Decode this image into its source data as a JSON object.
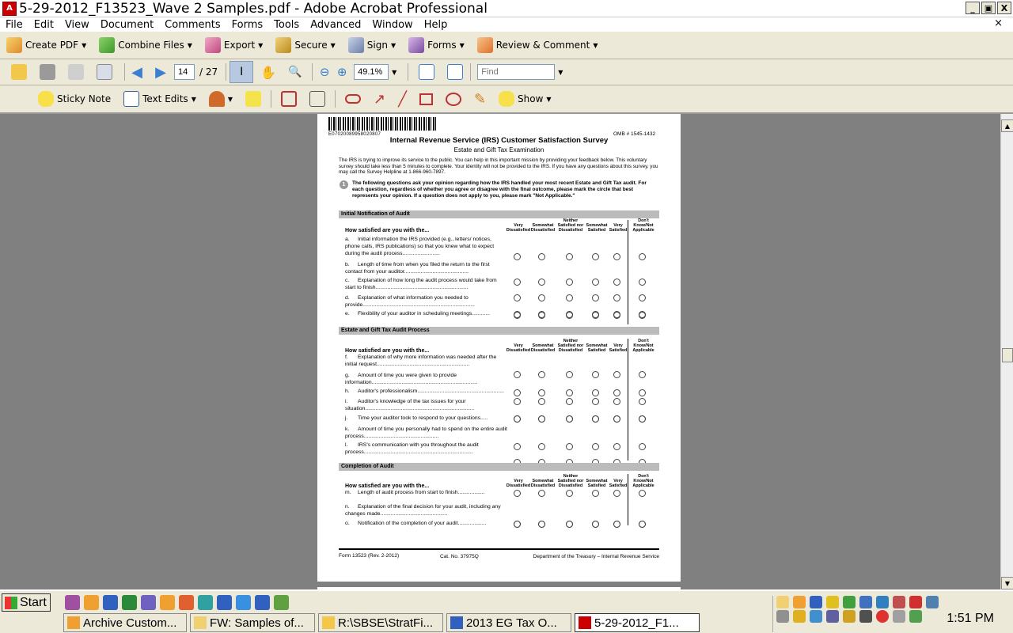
{
  "window": {
    "title": "5-29-2012_F13523_Wave 2 Samples.pdf - Adobe Acrobat Professional",
    "pdf_badge": "A"
  },
  "menu": [
    "File",
    "Edit",
    "View",
    "Document",
    "Comments",
    "Forms",
    "Tools",
    "Advanced",
    "Window",
    "Help"
  ],
  "window_controls": {
    "minimize": "_",
    "restore": "▣",
    "close": "X",
    "doc_close": "×"
  },
  "toolbar1": {
    "create_pdf": "Create PDF",
    "combine": "Combine Files",
    "export": "Export",
    "secure": "Secure",
    "sign": "Sign",
    "forms": "Forms",
    "review": "Review & Comment"
  },
  "toolbar2": {
    "page_current": "14",
    "page_total": "/ 27",
    "zoom": "49.1%",
    "find_placeholder": "Find"
  },
  "toolbar3": {
    "sticky": "Sticky Note",
    "text_edits": "Text Edits",
    "show": "Show"
  },
  "doc": {
    "barcode_text": "E07020089958020807",
    "omb": "OMB # 1545-1432",
    "title": "Internal Revenue Service (IRS) Customer Satisfaction Survey",
    "subtitle": "Estate and Gift Tax Examination",
    "intro": "The IRS is trying to improve its service to the public. You can help in this important mission by providing your feedback below. This voluntary survey should take less than 5 minutes to complete. Your identity will not be provided to the IRS. If you have any questions about this survey, you may call the Survey Helpline at 1-866-960-7897.",
    "q1_num": "1",
    "q1_text": "The following questions ask your opinion regarding how the IRS handled your most recent Estate and Gift Tax audit. For each question, regardless of whether you agree or disagree with the final outcome, please mark the circle that best represents your opinion. If a question does not apply to you, please mark \"Not Applicable.\"",
    "how_satisfied": "How satisfied are you with the...",
    "columns": [
      "Very Dissatisfied",
      "Somewhat Dissatisfied",
      "Neither Satisfied nor Dissatisfied",
      "Somewhat Satisfied",
      "Very Satisfied",
      "Don't Know/Not Applicable"
    ],
    "sections": [
      {
        "title": "Initial Notification of Audit",
        "items": [
          {
            "letter": "a.",
            "text": "Initial information the IRS provided (e.g., letters/ notices, phone calls, IRS publications) so that you knew what to expect during the audit process........................."
          },
          {
            "letter": "b.",
            "text": "Length of time from when you filed the return to the first contact from your auditor..........................................."
          },
          {
            "letter": "c.",
            "text": "Explanation of how long the audit process would take from start to finish.............................................................."
          },
          {
            "letter": "d.",
            "text": "Explanation of what information you needed to provide..........................................................................."
          },
          {
            "letter": "e.",
            "text": "Flexibility of your auditor in scheduling meetings............"
          }
        ]
      },
      {
        "title": "Estate and Gift Tax Audit Process",
        "items": [
          {
            "letter": "f.",
            "text": "Explanation of why more information was needed after the initial request.............................................................."
          },
          {
            "letter": "g.",
            "text": "Amount of time you were given to provide information......................................................................."
          },
          {
            "letter": "h.",
            "text": "Auditor's professionalism.........................................................."
          },
          {
            "letter": "i.",
            "text": "Auditor's knowledge of the tax issues for your situation........................................................................."
          },
          {
            "letter": "j.",
            "text": "Time your auditor took to respond to your questions....."
          },
          {
            "letter": "k.",
            "text": "Amount of time you personally had to spend on the entire audit process.................................................."
          },
          {
            "letter": "l.",
            "text": "IRS's communication with you throughout the audit process........................................................................."
          }
        ]
      },
      {
        "title": "Completion of Audit",
        "items": [
          {
            "letter": "m.",
            "text": "Length of audit process from start to finish.................."
          },
          {
            "letter": "n.",
            "text": "Explanation of the final decision for your audit, including any changes made............................................."
          },
          {
            "letter": "o.",
            "text": "Notification of the completion of your audit..................."
          }
        ]
      }
    ],
    "footer_form": "Form 13523 (Rev. 2-2012)",
    "footer_cat": "Cat. No. 37975Q",
    "footer_dept": "Department of the Treasury – Internal Revenue Service"
  },
  "taskbar": {
    "start": "Start",
    "tasks": [
      "Archive Custom...",
      "FW: Samples of...",
      "R:\\SBSE\\StratFi...",
      "2013 EG Tax O...",
      "5-29-2012_F1..."
    ],
    "clock": "1:51 PM"
  },
  "colors": {
    "toolbar": "#ece9d8",
    "doc_bg": "#808080",
    "section_header": "#bbbbbb"
  }
}
